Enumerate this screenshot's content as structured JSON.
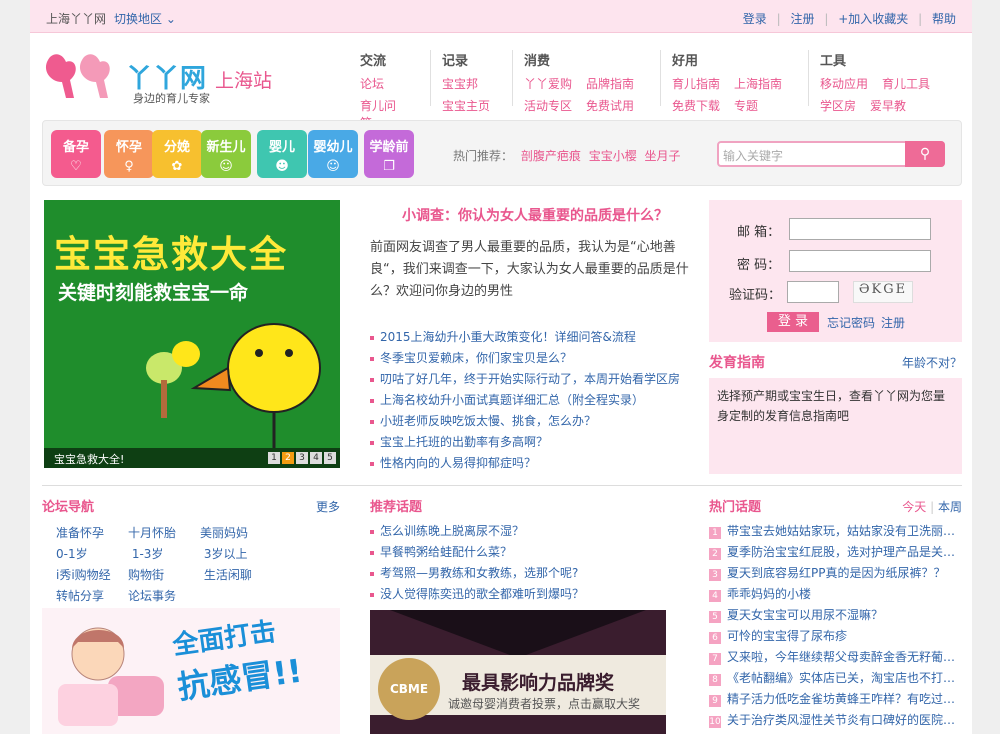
{
  "topbar": {
    "city": "上海丫丫网",
    "switch": "切换地区",
    "links": [
      "登录",
      "注册",
      "+加入收藏夹",
      "帮助"
    ]
  },
  "logo": {
    "brand": "丫丫网",
    "station": "上海站",
    "slogan": "身边的育儿专家"
  },
  "nav": [
    {
      "title": "交流",
      "links": [
        "论坛",
        "育儿问答"
      ]
    },
    {
      "title": "记录",
      "links": [
        "宝宝邦",
        "宝宝主页"
      ]
    },
    {
      "title": "消费",
      "links": [
        "丫丫爱购",
        "品牌指南",
        "活动专区",
        "免费试用"
      ]
    },
    {
      "title": "好用",
      "links": [
        "育儿指南",
        "上海指南",
        "免费下载",
        "专题"
      ]
    },
    {
      "title": "工具",
      "links": [
        "移动应用",
        "育儿工具",
        "学区房",
        "爱早教"
      ]
    }
  ],
  "categories": [
    {
      "label": "备孕",
      "color": "#f45b8e",
      "icon": "heart-icon"
    },
    {
      "label": "怀孕",
      "color": "#f6965b",
      "icon": "pregnant-icon"
    },
    {
      "label": "分娩",
      "color": "#f7c02f",
      "icon": "flower-icon"
    },
    {
      "label": "新生儿",
      "color": "#8bcb3c",
      "icon": "baby-icon"
    },
    {
      "label": "婴儿",
      "color": "#3fc6b0",
      "icon": "stroller-icon"
    },
    {
      "label": "婴幼儿",
      "color": "#49a9e6",
      "icon": "smile-icon"
    },
    {
      "label": "学龄前",
      "color": "#c46ad9",
      "icon": "book-icon"
    }
  ],
  "hot": {
    "label": "热门推荐：",
    "links": [
      "剖腹产疤痕",
      "宝宝小樱",
      "坐月子"
    ]
  },
  "search": {
    "placeholder": "输入关键字"
  },
  "banner": {
    "title": "宝宝急救大全",
    "subtitle": "关键时刻能救宝宝一命",
    "caption": "宝宝急救大全!",
    "pages": [
      "1",
      "2",
      "3",
      "4",
      "5"
    ],
    "active_page": "2"
  },
  "survey": {
    "title": "小调查：你认为女人最重要的品质是什么？",
    "body": "前面网友调查了男人最重要的品质，我认为是“心地善良“，我们来调查一下，大家认为女人最重要的品质是什么？欢迎问你身边的男性"
  },
  "news": [
    "2015上海幼升小重大政策变化！详细问答&流程",
    "冬季宝贝爱赖床，你们家宝贝是么？",
    "叨咕了好几年，终于开始实际行动了，本周开始看学区房",
    "上海名校幼升小面试真题详细汇总（附全程实录）",
    "小班老师反映吃饭太慢、挑食，怎么办？",
    "宝宝上托班的出勤率有多高啊？",
    "性格内向的人易得抑郁症吗？"
  ],
  "login": {
    "email_label": "邮  箱：",
    "password_label": "密  码：",
    "captcha_label": "验证码：",
    "captcha_text": "ӘKGE",
    "submit": "登 录",
    "forgot": "忘记密码",
    "register": "注册"
  },
  "growth": {
    "title": "发育指南",
    "more": "年龄不对？",
    "body": "选择预产期或宝宝生日，查看丫丫网为您量身定制的发育信息指南吧"
  },
  "forum": {
    "title": "论坛导航",
    "more": "更多",
    "items": [
      "准备怀孕",
      "十月怀胎",
      "美丽妈妈",
      "0-1岁",
      "1-3岁",
      "3岁以上",
      "i秀i购物经",
      "购物街",
      "生活闲聊",
      "转帖分享",
      "论坛事务"
    ]
  },
  "flu": {
    "line1": "全面打击",
    "line2": "抗感冒!!"
  },
  "topics": {
    "title": "推荐话题",
    "items": [
      "怎么训练晚上脱离尿不湿？",
      "早餐鸭粥给蛙配什么菜？",
      "考驾照—男教练和女教练，选那个呢?",
      "没人觉得陈奕迅的歌全都难听到爆吗？"
    ]
  },
  "award": {
    "title": "最具影响力品牌奖",
    "subtitle": "诚邀母婴消费者投票，点击赢取大奖",
    "seal": "CBME"
  },
  "hottopic": {
    "title": "热门话题",
    "tab_today": "今天",
    "tab_week": "本周",
    "items": [
      "带宝宝去她姑姑家玩，姑姑家没有卫洗丽…",
      "夏季防治宝宝红屁股，选对护理产品是关…",
      "夏天到底容易红PP真的是因为纸尿裤？？",
      "乖乖妈妈的小楼",
      "夏天女宝宝可以用尿不湿嘛？",
      "可怜的宝宝得了尿布疹",
      "又来啦，今年继续帮父母卖醉金香无籽葡…",
      "《老帖翻编》实体店已关，淘宝店也不打…",
      "精子活力低吃金雀坊黄蜂王咋样？有吃过…",
      "关于治疗类风湿性关节炎有口碑好的医院…"
    ]
  }
}
